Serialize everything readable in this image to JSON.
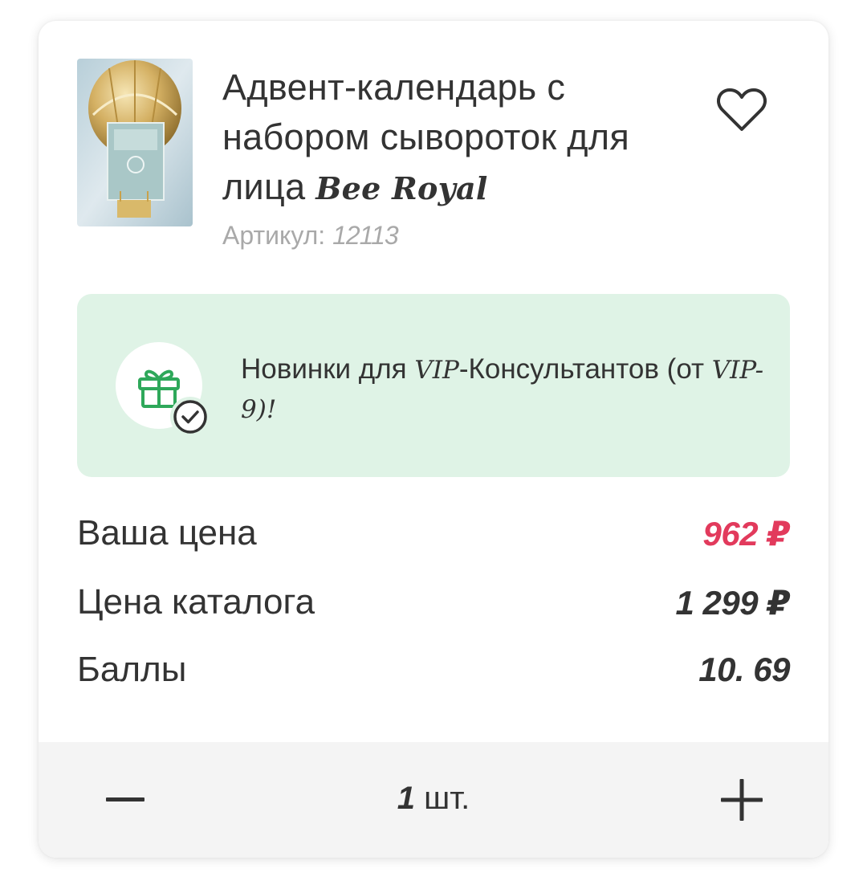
{
  "product": {
    "title_main": "Адвент-календарь с набором сывороток для лица ",
    "title_brand": "Bee Royal",
    "article_label": "Артикул: ",
    "article_number": "12113",
    "image_icon": "hot-air-balloon-advent-calendar-image"
  },
  "actions": {
    "favorite_icon": "heart-outline-icon"
  },
  "banner": {
    "text_1": "Новинки для ",
    "vip_1": "VIP",
    "text_2": "-Консультантов (от ",
    "vip_2": "VIP-9",
    "text_3": ")!",
    "icon": "gift-icon",
    "badge_icon": "check-circle-icon",
    "background_color": "#dff3e6",
    "icon_color": "#2ea85a"
  },
  "prices": {
    "your_price_label": "Ваша цена",
    "your_price_value": "962 ₽",
    "catalog_price_label": "Цена каталога",
    "catalog_price_value": "1 299 ₽",
    "points_label": "Баллы",
    "points_value": "10. 69",
    "accent_color": "#e23a5c"
  },
  "quantity": {
    "minus_icon": "minus-icon",
    "plus_icon": "plus-icon",
    "value": "1",
    "unit": " шт."
  }
}
